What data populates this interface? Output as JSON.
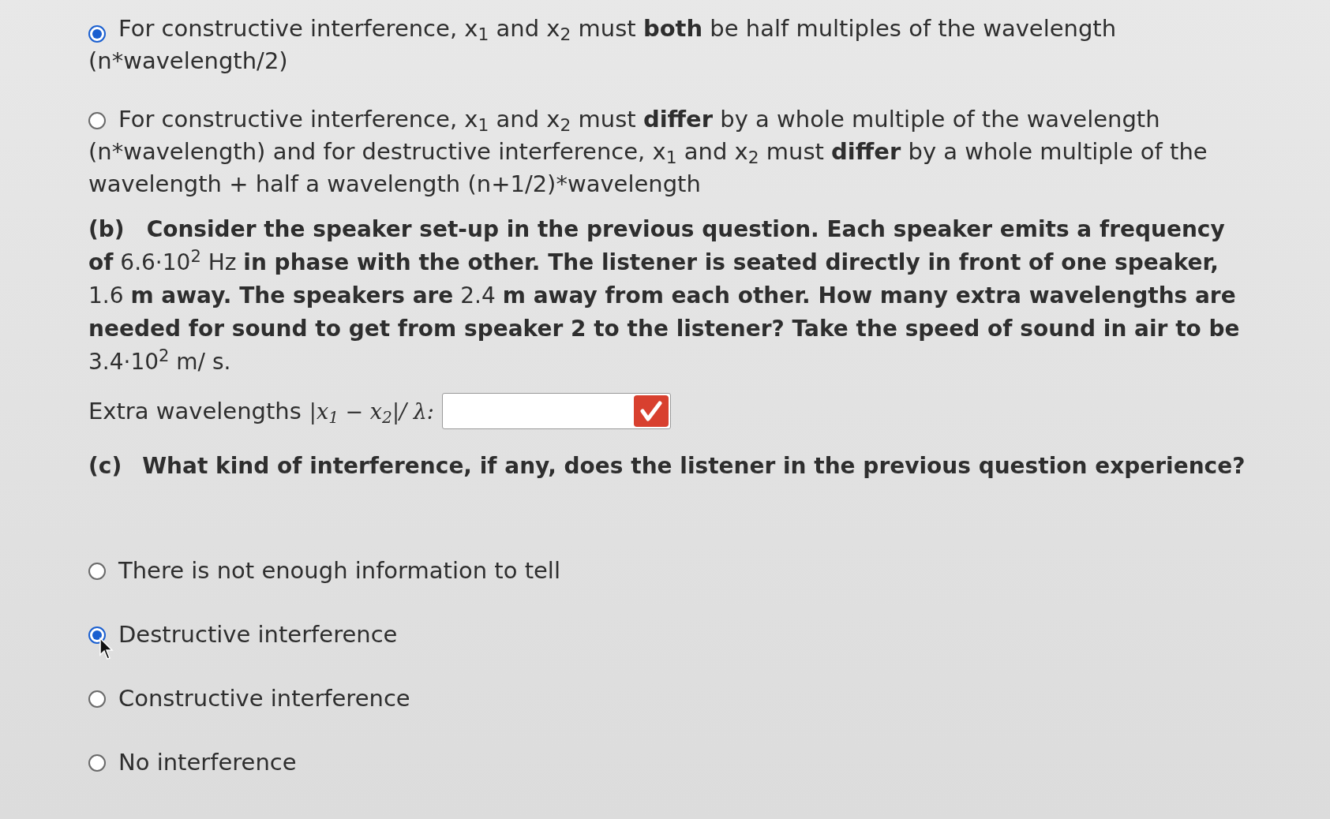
{
  "options_a": [
    {
      "text": "For constructive interference, x$_{1}$ and x$_{2}$  must **both** be half multiples of the wavelength (n*wavelength/2)",
      "selected": true
    },
    {
      "text": "For constructive interference, x$_{1}$  and x$_{2}$  must **differ** by a whole multiple of the wavelength (n*wavelength) and for destructive interference,  x$_{1}$ and x$_{2}$ must **differ** by a whole multiple of the wavelength + half a wavelength (n+1/2)*wavelength",
      "selected": false
    }
  ],
  "part_b": {
    "label": "(b)",
    "question": "**Consider the speaker set-up in the previous question.  Each speaker emits a frequency of** 6.6·10$^{2}$ Hz **in phase with the other.  The listener is seated directly in front of one speaker,** 1.6 **m away.  The speakers are** 2.4 **m away from each other.  How many extra wavelengths are needed for sound to get from speaker 2 to the listener?  Take the speed of sound in air to be** 3.4·10$^{2}$ m/ s.",
    "answer_label": "Extra wavelengths",
    "answer_formula": "|x$_{1}$ − x$_{2}$|/ λ:"
  },
  "part_c": {
    "label": "(c)",
    "question": "What kind of interference, if any, does the listener in the previous question experience?",
    "options": [
      {
        "text": "There is not enough information to tell",
        "selected": false
      },
      {
        "text": "Destructive interference",
        "selected": true
      },
      {
        "text": "Constructive interference",
        "selected": false
      },
      {
        "text": "No interference",
        "selected": false
      }
    ]
  }
}
